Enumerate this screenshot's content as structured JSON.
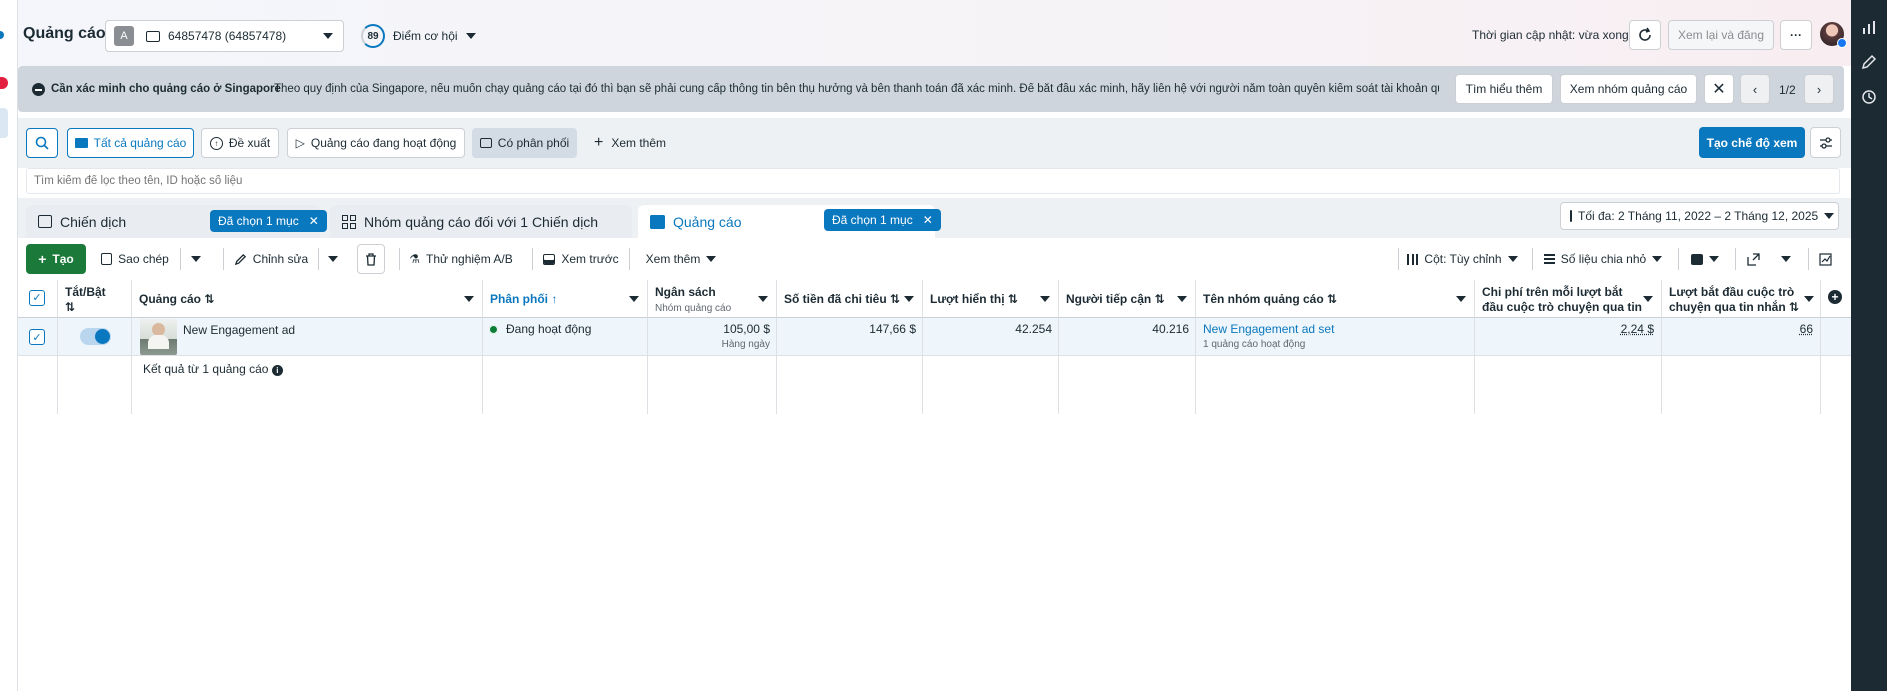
{
  "header": {
    "title": "Quảng cáo",
    "account_badge": "A",
    "account_name": "64857478 (64857478)",
    "score_badge": "89",
    "score_label": "Điểm cơ hội",
    "update_status": "Thời gian cập nhật: vừa xong",
    "review_publish": "Xem lại và đăng",
    "more_label": "···"
  },
  "banner": {
    "title": "Cần xác minh cho quảng cáo ở Singapore",
    "message": "Theo quy định của Singapore, nếu muốn chạy quảng cáo tại đó thì bạn sẽ phải cung cấp thông tin bên thụ hưởng và bên thanh toán đã xác minh. Để bắt đầu xác minh, hãy liên hệ với người nắm toàn quyền kiểm soát tài khoản quản...",
    "learn_more": "Tìm hiểu thêm",
    "view_adsets": "Xem nhóm quảng cáo",
    "pager": "1/2"
  },
  "filters": {
    "all_ads": "Tất cả quảng cáo",
    "suggested": "Đề xuất",
    "active_ads": "Quảng cáo đang hoạt động",
    "delivering": "Có phân phối",
    "see_more": "Xem thêm",
    "create_view": "Tạo chế độ xem"
  },
  "search": {
    "placeholder": "Tìm kiếm để lọc theo tên, ID hoặc số liệu"
  },
  "tabs": {
    "campaigns": "Chiến dịch",
    "campaigns_selected": "Đã chọn 1 mục",
    "adsets": "Nhóm quảng cáo đối với 1 Chiến dịch",
    "ads": "Quảng cáo",
    "ads_selected": "Đã chọn 1 mục",
    "date_range": "Tối đa: 2 Tháng 11, 2022 – 2 Tháng 12, 2025"
  },
  "toolbar": {
    "create": "Tạo",
    "duplicate": "Sao chép",
    "edit": "Chỉnh sửa",
    "ab_test": "Thử nghiệm A/B",
    "preview": "Xem trước",
    "more": "Xem thêm",
    "columns": "Cột: Tùy chỉnh",
    "breakdown": "Số liệu chia nhỏ"
  },
  "table": {
    "headers": {
      "toggle": "Tắt/Bật",
      "ad": "Quảng cáo",
      "delivery": "Phân phối",
      "budget": "Ngân sách",
      "budget_sub": "Nhóm quảng cáo",
      "spent": "Số tiền đã chi tiêu",
      "impressions": "Lượt hiển thị",
      "reach": "Người tiếp cận",
      "adset_name": "Tên nhóm quảng cáo",
      "cost_per_conv": "Chi phí trên mỗi lượt bắt đầu cuộc trò chuyện qua tin nhắ...",
      "conversations": "Lượt bắt đầu cuộc trò chuyện qua tin nhắn"
    },
    "row": {
      "ad_name": "New Engagement ad",
      "delivery": "Đang hoạt động",
      "budget": "105,00 $",
      "budget_sub": "Hàng ngày",
      "spent": "147,66 $",
      "impressions": "42.254",
      "reach": "40.216",
      "adset_name": "New Engagement ad set",
      "adset_sub": "1 quảng cáo hoạt động",
      "cost_per_conv": "2,24 $",
      "conversations": "66"
    },
    "summary": "Kết quả từ 1 quảng cáo"
  },
  "colors": {
    "primary": "#0a78be",
    "create_green": "#1b7a3a",
    "active_dot": "#0a7d36"
  }
}
